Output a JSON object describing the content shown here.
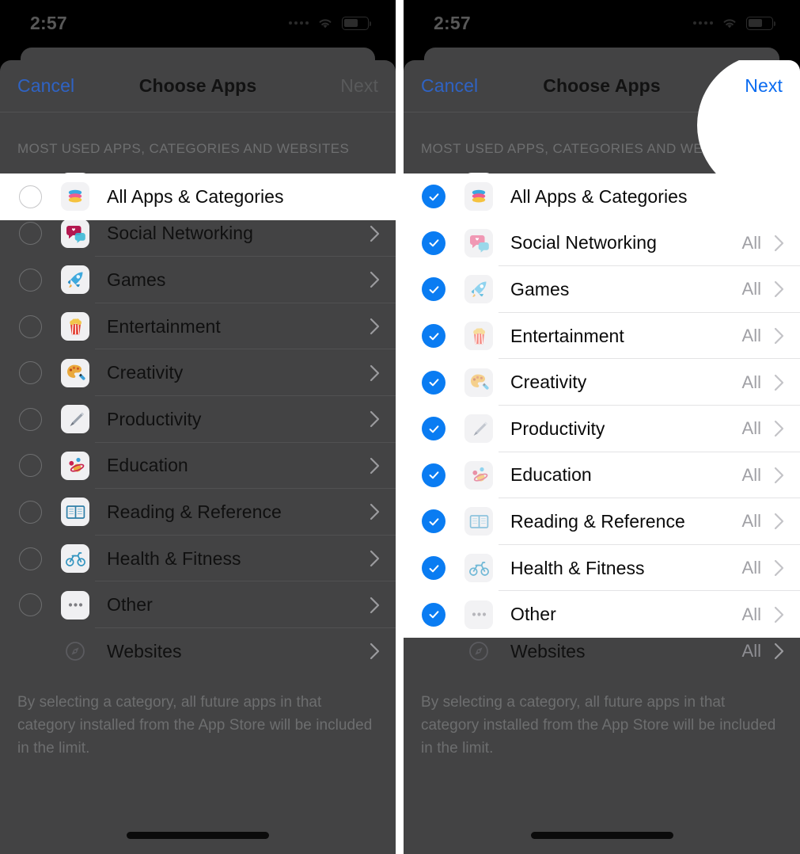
{
  "status_bar": {
    "time": "2:57",
    "signal_icon": "signal-dots-icon",
    "wifi_icon": "wifi-icon",
    "battery_icon": "battery-icon"
  },
  "nav": {
    "cancel_label": "Cancel",
    "title": "Choose Apps",
    "next_label": "Next"
  },
  "section_header": "MOST USED APPS, CATEGORIES AND WEBSITES",
  "footer_note": "By selecting a category, all future apps in that category installed from the App Store will be included in the limit.",
  "value_all": "All",
  "colors": {
    "accent_blue": "#0a7cf2",
    "cancel_blue": "#2f63c4",
    "next_blue": "#0a6bf0",
    "sheet_bg": "#434344",
    "spotlight_bg": "#ffffff",
    "muted_text": "#6e6f70"
  },
  "rows": [
    {
      "label": "All Apps & Categories",
      "icon": "stack-layers-icon",
      "has_chevron": false,
      "value": ""
    },
    {
      "label": "Social Networking",
      "icon": "chat-heart-icon",
      "has_chevron": true,
      "value": "All"
    },
    {
      "label": "Games",
      "icon": "rocket-icon",
      "has_chevron": true,
      "value": "All"
    },
    {
      "label": "Entertainment",
      "icon": "popcorn-icon",
      "has_chevron": true,
      "value": "All"
    },
    {
      "label": "Creativity",
      "icon": "palette-icon",
      "has_chevron": true,
      "value": "All"
    },
    {
      "label": "Productivity",
      "icon": "pen-check-icon",
      "has_chevron": true,
      "value": "All"
    },
    {
      "label": "Education",
      "icon": "planet-atom-icon",
      "has_chevron": true,
      "value": "All"
    },
    {
      "label": "Reading & Reference",
      "icon": "open-book-icon",
      "has_chevron": true,
      "value": "All"
    },
    {
      "label": "Health & Fitness",
      "icon": "bicycle-icon",
      "has_chevron": true,
      "value": "All"
    },
    {
      "label": "Other",
      "icon": "ellipsis-icon",
      "has_chevron": true,
      "value": "All"
    },
    {
      "label": "Websites",
      "icon": "compass-icon",
      "has_chevron": true,
      "value": "All"
    }
  ],
  "left_panel": {
    "selection_state": "none-selected",
    "control": "radio-unchecked",
    "next_enabled": false,
    "spotlight_rows": [
      0
    ]
  },
  "right_panel": {
    "selection_state": "all-selected",
    "control": "checkmark-checked",
    "next_enabled": true,
    "spotlight_rows": [
      0,
      1,
      2,
      3,
      4,
      5,
      6,
      7,
      8,
      9
    ],
    "next_highlight": true
  }
}
